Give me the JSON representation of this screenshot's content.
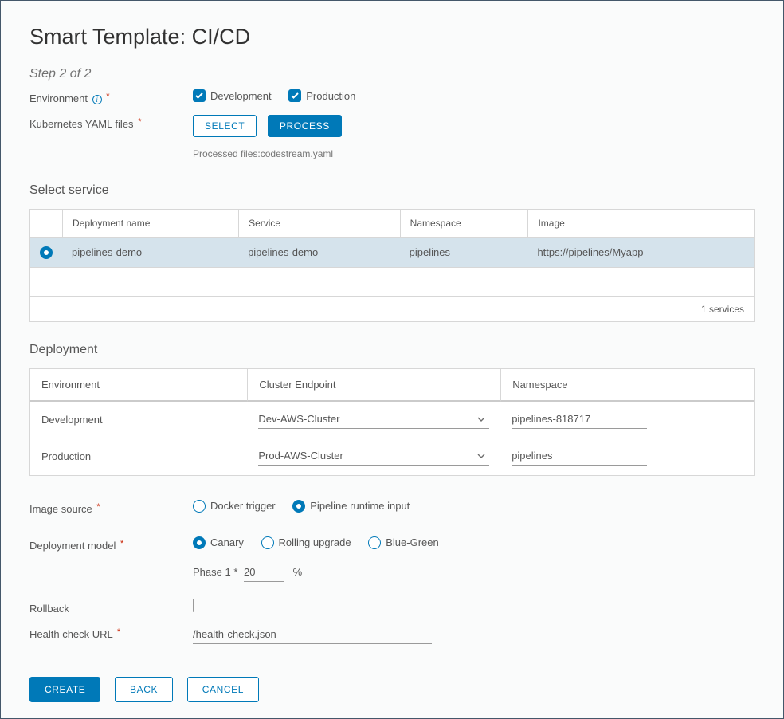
{
  "title": "Smart Template: CI/CD",
  "step": "Step 2 of 2",
  "fields": {
    "environment": {
      "label": "Environment",
      "options": [
        {
          "label": "Development",
          "checked": true
        },
        {
          "label": "Production",
          "checked": true
        }
      ]
    },
    "yaml": {
      "label": "Kubernetes YAML files",
      "select_btn": "Select",
      "process_btn": "Process",
      "processed_prefix": "Processed files:",
      "processed_file": "codestream.yaml"
    }
  },
  "service": {
    "heading": "Select service",
    "columns": [
      "Deployment name",
      "Service",
      "Namespace",
      "Image"
    ],
    "rows": [
      {
        "selected": true,
        "deployment_name": "pipelines-demo",
        "service": "pipelines-demo",
        "namespace": "pipelines",
        "image": "https://pipelines/Myapp"
      }
    ],
    "footer": "1 services"
  },
  "deployment": {
    "heading": "Deployment",
    "columns": [
      "Environment",
      "Cluster Endpoint",
      "Namespace"
    ],
    "rows": [
      {
        "env": "Development",
        "cluster": "Dev-AWS-Cluster",
        "namespace": "pipelines-818717"
      },
      {
        "env": "Production",
        "cluster": "Prod-AWS-Cluster",
        "namespace": "pipelines"
      }
    ]
  },
  "image_source": {
    "label": "Image source",
    "options": [
      {
        "label": "Docker trigger",
        "selected": false
      },
      {
        "label": "Pipeline runtime input",
        "selected": true
      }
    ]
  },
  "deployment_model": {
    "label": "Deployment model",
    "options": [
      {
        "label": "Canary",
        "selected": true
      },
      {
        "label": "Rolling upgrade",
        "selected": false
      },
      {
        "label": "Blue-Green",
        "selected": false
      }
    ],
    "phase_label": "Phase 1",
    "phase_value": "20",
    "phase_unit": "%"
  },
  "rollback": {
    "label": "Rollback",
    "checked": false
  },
  "health": {
    "label": "Health check URL",
    "value": "/health-check.json"
  },
  "actions": {
    "create": "Create",
    "back": "Back",
    "cancel": "Cancel"
  }
}
